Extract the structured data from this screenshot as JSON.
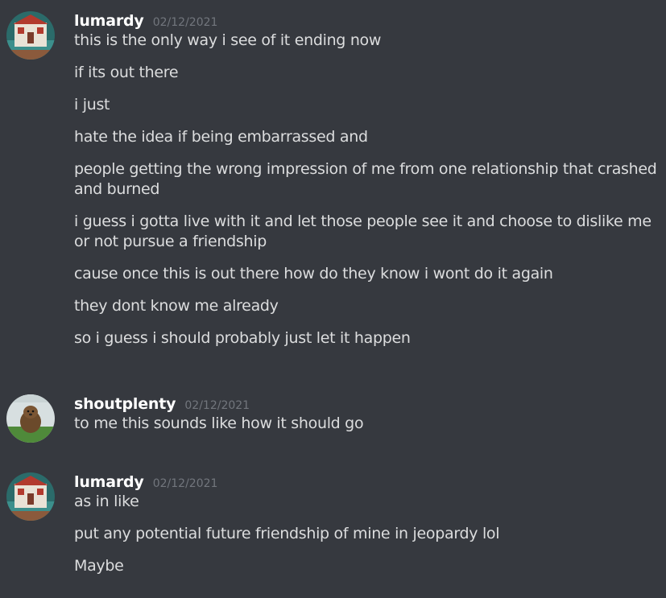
{
  "messages": [
    {
      "username": "lumardy",
      "timestamp": "02/12/2021",
      "avatar_icon": "house-avatar-icon",
      "lines": [
        "this is the only way i see of it ending now",
        "if its out there",
        "i just",
        "hate the idea if being embarrassed and",
        "people getting the wrong impression of me from one relationship that crashed and burned",
        "i guess i gotta live with it and let those people see it and choose to dislike me or not pursue a friendship",
        "cause once this is out there how do they know i wont do it again",
        "they dont know me already",
        "so i guess i should probably just let it happen"
      ]
    },
    {
      "username": "shoutplenty",
      "timestamp": "02/12/2021",
      "avatar_icon": "otter-avatar-icon",
      "lines": [
        "to me this sounds like how it should go"
      ]
    },
    {
      "username": "lumardy",
      "timestamp": "02/12/2021",
      "avatar_icon": "house-avatar-icon",
      "lines": [
        "as in like",
        "put any potential future friendship of mine in jeopardy lol",
        "Maybe"
      ]
    }
  ],
  "colors": {
    "background": "#36393f",
    "username": "#ffffff",
    "text": "#dcddde",
    "timestamp": "#72767d"
  }
}
